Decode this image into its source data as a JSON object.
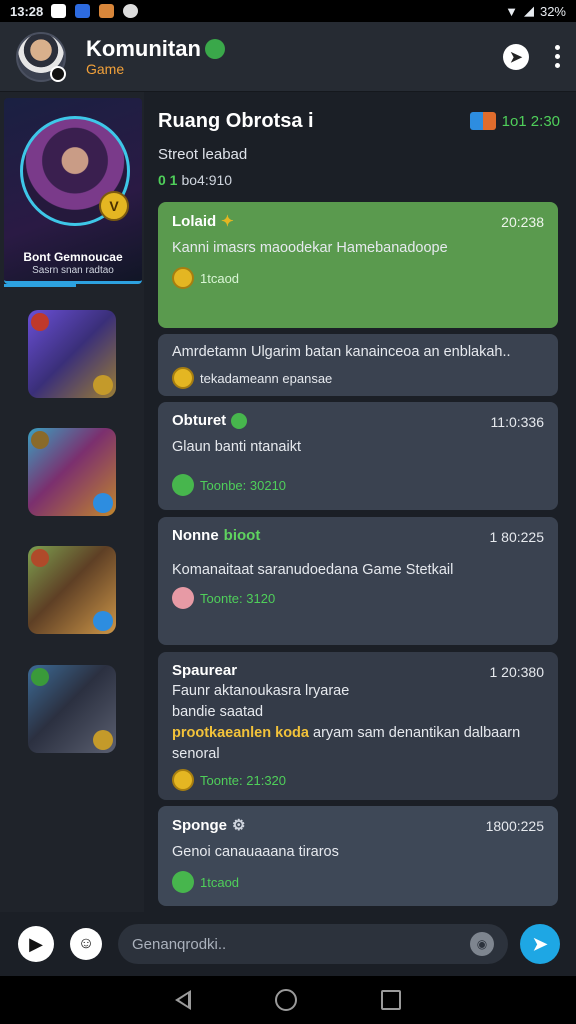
{
  "status_bar": {
    "time": "13:28",
    "battery": "32%"
  },
  "app_bar": {
    "title": "Komunitan",
    "subtitle": "Game"
  },
  "sidebar": {
    "selected": {
      "name": "Bont Gemnoucae",
      "sub": "Sasrn snan radtao",
      "badge": "V"
    },
    "thumbs": [
      "game-1",
      "game-2",
      "game-3",
      "game-4"
    ]
  },
  "room": {
    "title": "Ruang Obrotsa i",
    "subtitle": "Streot leabad",
    "count": "0 1",
    "count_label": "bo4:910",
    "time": "1o1 2:30"
  },
  "messages": [
    {
      "name": "Lolaid",
      "time": "20:238",
      "body": "Kanni imasrs maoodekar Hamebanadoope",
      "react": "1tcaod"
    },
    {
      "body": "Amrdetamn Ulgarim batan kanainceoa an enblakah..",
      "react": "tekadameann epansae"
    },
    {
      "name": "Obturet",
      "time": "11:0:336",
      "body": "Glaun banti ntanaikt",
      "react": "Toonbe: 30210"
    },
    {
      "name": "Nonne",
      "name_hl": "bioot",
      "time": "1 80:225",
      "body": "Komanaitaat saranudoedana Game Stetkail",
      "react": "Toonte: 3120"
    },
    {
      "name": "Spaurear",
      "time": "1 20:380",
      "body1": "Faunr aktanoukasra lryarae",
      "body2": "bandie saatad",
      "body3_hl": "prootkaeanlen koda",
      "body3": "aryam sam denantikan dalbaarn",
      "body4": "senoral",
      "react": "Toonte: 21:320"
    },
    {
      "name": "Sponge",
      "time": "1800:225",
      "body": "Genoi canauaaana tiraros",
      "react": "1tcaod"
    }
  ],
  "composer": {
    "placeholder": "Genanqrodki.."
  },
  "colors": {
    "accent": "#1ea7e4",
    "green": "#4fcf5a",
    "bubble_green": "#5a9a4e",
    "bubble": "#3a4250"
  }
}
